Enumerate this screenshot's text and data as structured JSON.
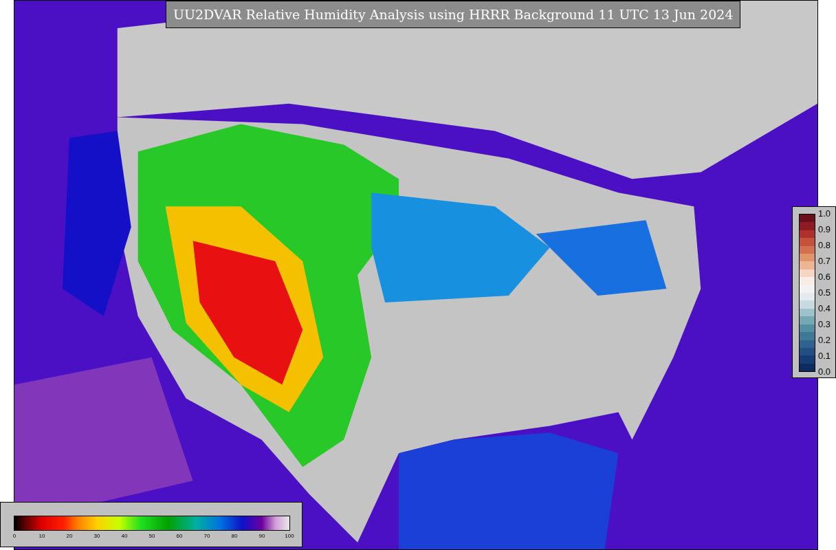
{
  "title": "UU2DVAR Relative Humidity Analysis using HRRR Background 11 UTC 13 Jun 2024",
  "humidity_colorbar": {
    "ticks": [
      "0",
      "10",
      "20",
      "30",
      "40",
      "50",
      "60",
      "70",
      "80",
      "90",
      "100"
    ]
  },
  "weight_colorbar": {
    "ticks": [
      "1.0",
      "0.9",
      "0.8",
      "0.7",
      "0.6",
      "0.5",
      "0.4",
      "0.3",
      "0.2",
      "0.1",
      "0.0"
    ]
  }
}
